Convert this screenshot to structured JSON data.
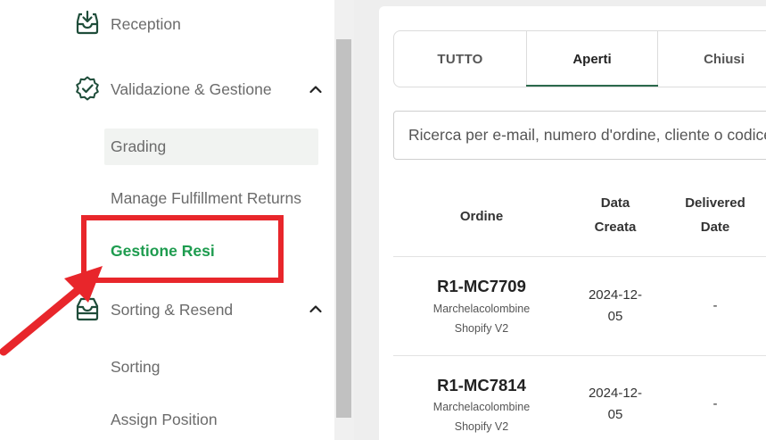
{
  "sidebar": {
    "items": [
      {
        "label": "Reception",
        "icon": "inbox-download-icon"
      },
      {
        "label": "Validazione & Gestione",
        "icon": "verified-badge-icon",
        "expanded": true,
        "children": [
          {
            "label": "Grading"
          },
          {
            "label": "Manage Fulfillment Returns"
          },
          {
            "label": "Gestione Resi",
            "active": true
          }
        ]
      },
      {
        "label": "Sorting & Resend",
        "icon": "tray-icon",
        "expanded": true,
        "children": [
          {
            "label": "Sorting"
          },
          {
            "label": "Assign Position"
          }
        ]
      }
    ]
  },
  "tabs": [
    {
      "label": "TUTTO"
    },
    {
      "label": "Aperti",
      "active": true
    },
    {
      "label": "Chiusi"
    }
  ],
  "search": {
    "placeholder": "Ricerca per e-mail, numero d'ordine, cliente o codice"
  },
  "table": {
    "headers": {
      "ordine": "Ordine",
      "data_line1": "Data",
      "data_line2": "Creata",
      "delivered_line1": "Delivered",
      "delivered_line2": "Date"
    },
    "rows": [
      {
        "order": "R1-MC7709",
        "client": "Marchelacolombine",
        "platform": "Shopify V2",
        "date_line1": "2024-12-",
        "date_line2": "05",
        "delivered": "-"
      },
      {
        "order": "R1-MC7814",
        "client": "Marchelacolombine",
        "platform": "Shopify V2",
        "date_line1": "2024-12-",
        "date_line2": "05",
        "delivered": "-"
      }
    ]
  },
  "colors": {
    "accent": "#2b6a4c",
    "active_text": "#1e9c4f",
    "annotation": "#e8262b"
  }
}
